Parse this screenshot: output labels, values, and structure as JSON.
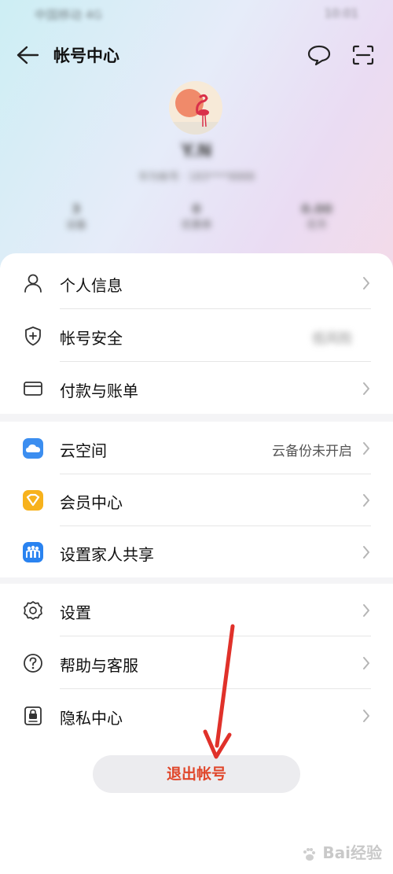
{
  "status_bar": {
    "left": "中国移动 4G",
    "right": "10:01"
  },
  "header": {
    "title": "帐号中心"
  },
  "profile": {
    "name": "Y.N",
    "subtitle": "华为帐号 · 183****8888"
  },
  "stats": [
    {
      "n": "3",
      "t": "设备"
    },
    {
      "n": "0",
      "t": "优惠券"
    },
    {
      "n": "0.00",
      "t": "花币"
    }
  ],
  "group1": {
    "items": [
      {
        "label": "个人信息",
        "icon": "person-icon"
      },
      {
        "label": "帐号安全",
        "icon": "shield-icon",
        "value": "低风险"
      },
      {
        "label": "付款与账单",
        "icon": "card-icon"
      }
    ]
  },
  "group2": {
    "items": [
      {
        "label": "云空间",
        "icon": "cloud-icon",
        "value": "云备份未开启"
      },
      {
        "label": "会员中心",
        "icon": "member-icon"
      },
      {
        "label": "设置家人共享",
        "icon": "family-icon"
      }
    ]
  },
  "group3": {
    "items": [
      {
        "label": "设置",
        "icon": "gear-icon"
      },
      {
        "label": "帮助与客服",
        "icon": "help-icon"
      },
      {
        "label": "隐私中心",
        "icon": "privacy-icon"
      }
    ]
  },
  "logout": {
    "label": "退出帐号"
  },
  "watermark": {
    "text": "经验"
  },
  "colors": {
    "logout_text": "#e0462a",
    "arrow": "#e0312a",
    "cloud": "#3c8ef0",
    "member": "#f7b21c",
    "family": "#2a83f0"
  }
}
